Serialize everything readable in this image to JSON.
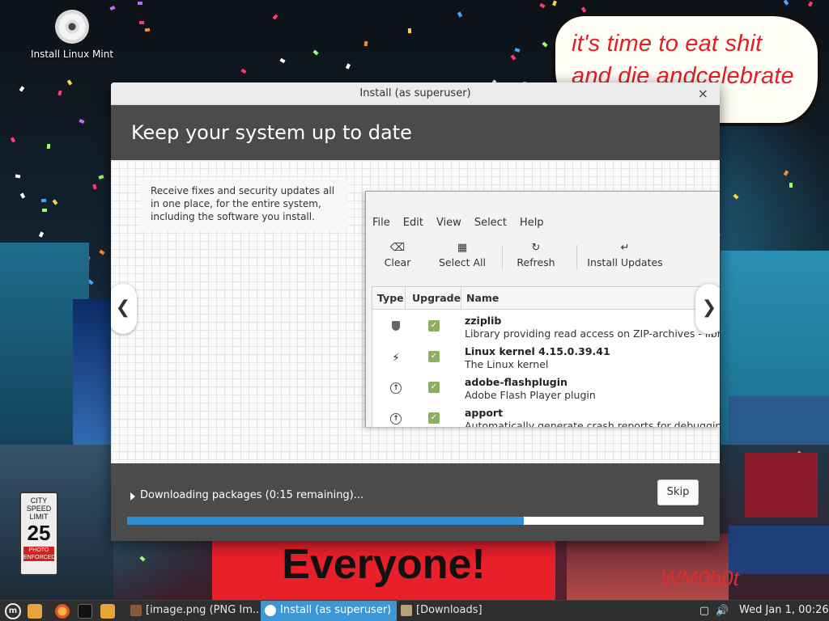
{
  "desktop": {
    "icon_label": "Install Linux Mint",
    "wallpaper_text": {
      "speech_line1": "it's time to eat shit",
      "speech_line2": "and die andcelebrate",
      "banner": "Everyone!",
      "watermark": "WM0b0t",
      "sign_line1": "CITY",
      "sign_line2": "SPEED",
      "sign_line3": "LIMIT",
      "sign_number": "25",
      "sign_line4": "PHOTO",
      "sign_line5": "ENFORCED"
    }
  },
  "window": {
    "title": "Install (as superuser)",
    "close_glyph": "×",
    "header_title": "Keep your system up to date",
    "description": "Receive fixes and security updates all in one place, for the entire system, including the software you install.",
    "prev_glyph": "❮",
    "next_glyph": "❯",
    "update_manager": {
      "menu": [
        "File",
        "Edit",
        "View",
        "Select",
        "Help"
      ],
      "toolbar": [
        {
          "label": "Clear",
          "icon": "⌫"
        },
        {
          "label": "Select All",
          "icon": "▦"
        },
        {
          "label": "Refresh",
          "icon": "↻"
        },
        {
          "label": "Install Updates",
          "icon": "↵"
        }
      ],
      "columns": [
        "Type",
        "Upgrade",
        "Name"
      ],
      "rows": [
        {
          "type": "security-shield-icon",
          "name": "zziplib",
          "desc": "Library providing read access on ZIP-archives - library"
        },
        {
          "type": "kernel-lightning-icon",
          "name": "Linux kernel 4.15.0.39.41",
          "desc": "The Linux kernel"
        },
        {
          "type": "upgrade-arrow-icon",
          "name": "adobe-flashplugin",
          "desc": "Adobe Flash Player plugin"
        },
        {
          "type": "upgrade-arrow-icon",
          "name": "apport",
          "desc": "Automatically generate crash reports for debugging"
        }
      ]
    },
    "footer": {
      "status": "Downloading packages (0:15 remaining)...",
      "skip_label": "Skip",
      "progress_fraction": 0.688
    }
  },
  "taskbar": {
    "tasks": [
      {
        "label": "[image.png (PNG Im...",
        "active": false
      },
      {
        "label": "Install (as superuser)",
        "active": true
      },
      {
        "label": "[Downloads]",
        "active": false
      }
    ],
    "clock": "Wed Jan  1, 00:26",
    "colors": {
      "active_task": "#3d97d5",
      "progress": "#2e8ed0",
      "header": "#4b4b4b"
    }
  }
}
